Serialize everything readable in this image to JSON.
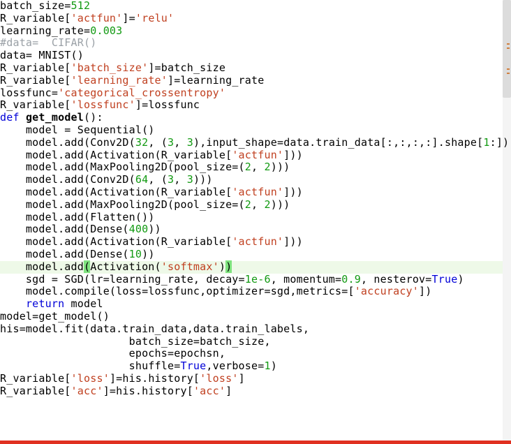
{
  "language": "python",
  "highlighted_line_index": 23,
  "lines": [
    {
      "segs": [
        [
          "op",
          "batch_size="
        ],
        [
          "nm",
          "512"
        ]
      ]
    },
    {
      "segs": [
        [
          "op",
          "R_variable["
        ],
        [
          "str",
          "'actfun'"
        ],
        [
          "op",
          "]="
        ],
        [
          "str",
          "'relu'"
        ]
      ]
    },
    {
      "segs": [
        [
          "op",
          "learning_rate="
        ],
        [
          "nm",
          "0.003"
        ]
      ]
    },
    {
      "segs": [
        [
          "cm",
          "#data=  CIFAR()"
        ]
      ]
    },
    {
      "segs": [
        [
          "op",
          "data= MNIST()"
        ]
      ]
    },
    {
      "segs": [
        [
          "op",
          ""
        ]
      ]
    },
    {
      "segs": [
        [
          "op",
          "R_variable["
        ],
        [
          "str",
          "'batch_size'"
        ],
        [
          "op",
          "]=batch_size"
        ]
      ]
    },
    {
      "segs": [
        [
          "op",
          "R_variable["
        ],
        [
          "str",
          "'learning_rate'"
        ],
        [
          "op",
          "]=learning_rate"
        ]
      ]
    },
    {
      "segs": [
        [
          "op",
          "lossfunc="
        ],
        [
          "str",
          "'categorical_crossentropy'"
        ]
      ]
    },
    {
      "segs": [
        [
          "op",
          "R_variable["
        ],
        [
          "str",
          "'lossfunc'"
        ],
        [
          "op",
          "]=lossfunc"
        ]
      ]
    },
    {
      "segs": [
        [
          "op",
          ""
        ]
      ]
    },
    {
      "segs": [
        [
          "kw",
          "def "
        ],
        [
          "fn",
          "get_model"
        ],
        [
          "op",
          "():"
        ]
      ]
    },
    {
      "segs": [
        [
          "op",
          "    model = Sequential()"
        ]
      ]
    },
    {
      "segs": [
        [
          "op",
          "    model.add(Conv2D("
        ],
        [
          "nm",
          "32"
        ],
        [
          "op",
          ", ("
        ],
        [
          "nm",
          "3"
        ],
        [
          "op",
          ", "
        ],
        [
          "nm",
          "3"
        ],
        [
          "op",
          "),input_shape=data.train_data[:,:,:,:].shape["
        ],
        [
          "nm",
          "1"
        ],
        [
          "op",
          ":])"
        ]
      ]
    },
    {
      "segs": [
        [
          "op",
          "    model.add(Activation(R_variable["
        ],
        [
          "str",
          "'actfun'"
        ],
        [
          "op",
          "]))"
        ]
      ]
    },
    {
      "segs": [
        [
          "op",
          "    model.add(MaxPooling2D(pool_size=("
        ],
        [
          "nm",
          "2"
        ],
        [
          "op",
          ", "
        ],
        [
          "nm",
          "2"
        ],
        [
          "op",
          ")))"
        ]
      ]
    },
    {
      "segs": [
        [
          "op",
          "    model.add(Conv2D("
        ],
        [
          "nm",
          "64"
        ],
        [
          "op",
          ", ("
        ],
        [
          "nm",
          "3"
        ],
        [
          "op",
          ", "
        ],
        [
          "nm",
          "3"
        ],
        [
          "op",
          ")))"
        ]
      ]
    },
    {
      "segs": [
        [
          "op",
          "    model.add(Activation(R_variable["
        ],
        [
          "str",
          "'actfun'"
        ],
        [
          "op",
          "]))"
        ]
      ]
    },
    {
      "segs": [
        [
          "op",
          "    model.add(MaxPooling2D(pool_size=("
        ],
        [
          "nm",
          "2"
        ],
        [
          "op",
          ", "
        ],
        [
          "nm",
          "2"
        ],
        [
          "op",
          ")))"
        ]
      ]
    },
    {
      "segs": [
        [
          "op",
          "    model.add(Flatten())"
        ]
      ]
    },
    {
      "segs": [
        [
          "op",
          "    model.add(Dense("
        ],
        [
          "nm",
          "400"
        ],
        [
          "op",
          "))"
        ]
      ]
    },
    {
      "segs": [
        [
          "op",
          "    model.add(Activation(R_variable["
        ],
        [
          "str",
          "'actfun'"
        ],
        [
          "op",
          "]))"
        ]
      ]
    },
    {
      "segs": [
        [
          "op",
          "    model.add(Dense("
        ],
        [
          "nm",
          "10"
        ],
        [
          "op",
          "))"
        ]
      ]
    },
    {
      "segs": [
        [
          "op",
          "    model.add"
        ],
        [
          "paren-hl",
          "("
        ],
        [
          "op",
          "Activation("
        ],
        [
          "str",
          "'softmax'"
        ],
        [
          "op",
          ")"
        ],
        [
          "paren-hl",
          ")"
        ]
      ]
    },
    {
      "segs": [
        [
          "op",
          "    sgd = SGD(lr=learning_rate, decay="
        ],
        [
          "nm",
          "1e-6"
        ],
        [
          "op",
          ", momentum="
        ],
        [
          "nm",
          "0.9"
        ],
        [
          "op",
          ", nesterov="
        ],
        [
          "kw",
          "True"
        ],
        [
          "op",
          ")"
        ]
      ]
    },
    {
      "segs": [
        [
          "op",
          "    model.compile(loss=lossfunc,optimizer=sgd,metrics=["
        ],
        [
          "str",
          "'accuracy'"
        ],
        [
          "op",
          "])"
        ]
      ]
    },
    {
      "segs": [
        [
          "op",
          "    "
        ],
        [
          "kw",
          "return"
        ],
        [
          "op",
          " model"
        ]
      ]
    },
    {
      "segs": [
        [
          "op",
          ""
        ]
      ]
    },
    {
      "segs": [
        [
          "op",
          "model=get_model()"
        ]
      ]
    },
    {
      "segs": [
        [
          "op",
          "his=model.fit(data.train_data,data.train_labels,"
        ]
      ]
    },
    {
      "segs": [
        [
          "op",
          "                    batch_size=batch_size,"
        ]
      ]
    },
    {
      "segs": [
        [
          "op",
          "                    epochs=epochsn,"
        ]
      ]
    },
    {
      "segs": [
        [
          "op",
          "                    shuffle="
        ],
        [
          "kw",
          "True"
        ],
        [
          "op",
          ",verbose="
        ],
        [
          "nm",
          "1"
        ],
        [
          "op",
          ")"
        ]
      ]
    },
    {
      "segs": [
        [
          "op",
          "R_variable["
        ],
        [
          "str",
          "'loss'"
        ],
        [
          "op",
          "]=his.history["
        ],
        [
          "str",
          "'loss'"
        ],
        [
          "op",
          "]"
        ]
      ]
    },
    {
      "segs": [
        [
          "op",
          "R_variable["
        ],
        [
          "str",
          "'acc'"
        ],
        [
          "op",
          "]=his.history["
        ],
        [
          "str",
          "'acc'"
        ],
        [
          "op",
          "]"
        ]
      ]
    }
  ]
}
